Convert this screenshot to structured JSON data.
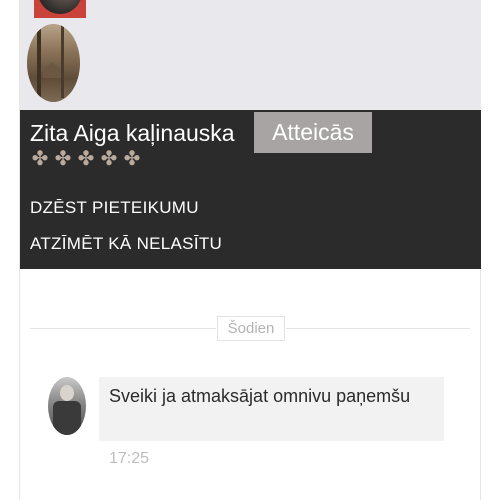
{
  "header": {
    "user_name": "Zita Aiga kaļinauska",
    "status_badge": "Atteicās",
    "rating_stars": [
      "✤",
      "✤",
      "✤",
      "✤",
      "✤"
    ]
  },
  "actions": {
    "delete_label": "DZĒST PIETEIKUMU",
    "mark_unread_label": "ATZĪMĒT KĀ NELASĪTU"
  },
  "conversation": {
    "date_divider": "Šodien",
    "messages": [
      {
        "text": "Sveiki ja atmaksājat omnivu paņemšu",
        "time": "17:25"
      }
    ]
  },
  "colors": {
    "header_bg": "#e9e8ec",
    "panel_bg": "#2b2b2b",
    "badge_bg": "#a8a4a4",
    "star_color": "#b9aa9c",
    "bubble_bg": "#f2f2f2"
  }
}
